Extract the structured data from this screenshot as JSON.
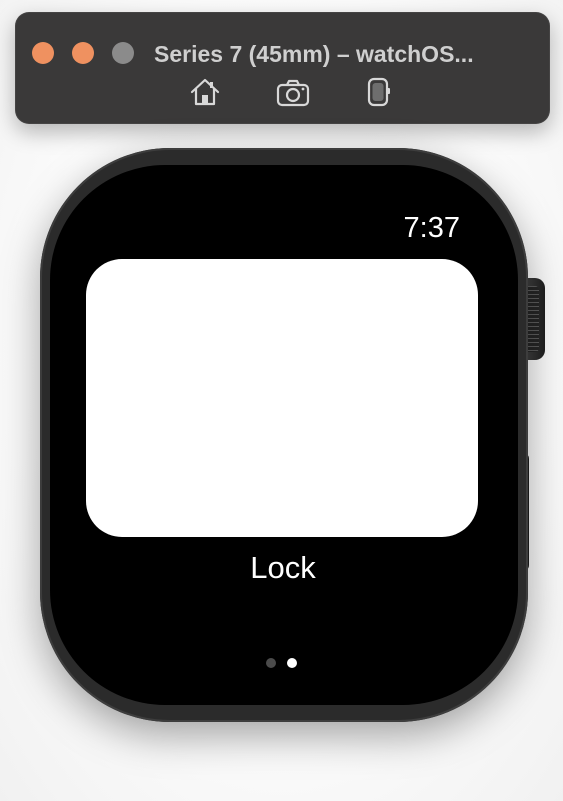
{
  "simulator": {
    "title": "Series 7 (45mm) – watchOS...",
    "toolbar": {
      "home_icon": "home-icon",
      "screenshot_icon": "camera-icon",
      "rotate_icon": "rotate-device-icon"
    },
    "window_controls": {
      "close_color": "#ef9160",
      "minimize_color": "#ef9160",
      "zoom_color": "#8b8b8b"
    }
  },
  "watch": {
    "status_time": "7:37",
    "card": {
      "label": "Lock"
    },
    "pager": {
      "total_pages": 2,
      "current_page": 2
    }
  }
}
